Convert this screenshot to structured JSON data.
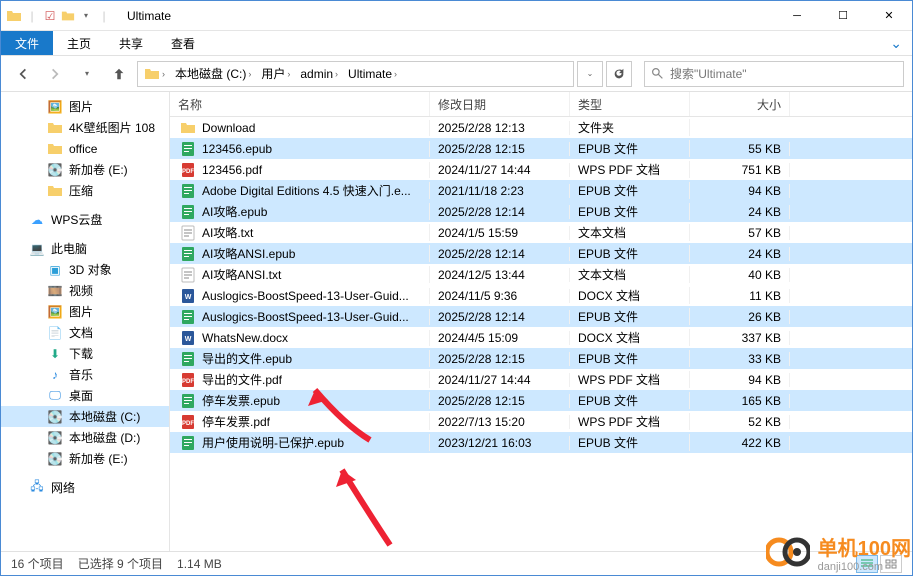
{
  "window_title": "Ultimate",
  "ribbon": {
    "file": "文件",
    "home": "主页",
    "share": "共享",
    "view": "查看"
  },
  "breadcrumbs": [
    "本地磁盘 (C:)",
    "用户",
    "admin",
    "Ultimate"
  ],
  "search_placeholder": "搜索\"Ultimate\"",
  "tree": {
    "pictures": "图片",
    "wallpaper": "4K壁纸图片 108",
    "office": "office",
    "volE": "新加卷 (E:)",
    "compress": "压缩",
    "wps": "WPS云盘",
    "thispc": "此电脑",
    "obj3d": "3D 对象",
    "videos": "视频",
    "pics2": "图片",
    "docs": "文档",
    "downloads": "下载",
    "music": "音乐",
    "desktop": "桌面",
    "volC": "本地磁盘 (C:)",
    "volD": "本地磁盘 (D:)",
    "volE2": "新加卷 (E:)",
    "network": "网络"
  },
  "columns": {
    "name": "名称",
    "date": "修改日期",
    "type": "类型",
    "size": "大小"
  },
  "rows": [
    {
      "name": "Download",
      "date": "2025/2/28 12:13",
      "type": "文件夹",
      "size": "",
      "icon": "folder",
      "sel": false
    },
    {
      "name": "123456.epub",
      "date": "2025/2/28 12:15",
      "type": "EPUB 文件",
      "size": "55 KB",
      "icon": "epub",
      "sel": true
    },
    {
      "name": "123456.pdf",
      "date": "2024/11/27 14:44",
      "type": "WPS PDF 文档",
      "size": "751 KB",
      "icon": "pdf",
      "sel": false
    },
    {
      "name": "Adobe Digital Editions 4.5 快速入门.e...",
      "date": "2021/11/18 2:23",
      "type": "EPUB 文件",
      "size": "94 KB",
      "icon": "epub",
      "sel": true
    },
    {
      "name": "AI攻略.epub",
      "date": "2025/2/28 12:14",
      "type": "EPUB 文件",
      "size": "24 KB",
      "icon": "epub",
      "sel": true
    },
    {
      "name": "AI攻略.txt",
      "date": "2024/1/5 15:59",
      "type": "文本文档",
      "size": "57 KB",
      "icon": "txt",
      "sel": false
    },
    {
      "name": "AI攻略ANSI.epub",
      "date": "2025/2/28 12:14",
      "type": "EPUB 文件",
      "size": "24 KB",
      "icon": "epub",
      "sel": true
    },
    {
      "name": "AI攻略ANSI.txt",
      "date": "2024/12/5 13:44",
      "type": "文本文档",
      "size": "40 KB",
      "icon": "txt",
      "sel": false
    },
    {
      "name": "Auslogics-BoostSpeed-13-User-Guid...",
      "date": "2024/11/5 9:36",
      "type": "DOCX 文档",
      "size": "11 KB",
      "icon": "docx",
      "sel": false
    },
    {
      "name": "Auslogics-BoostSpeed-13-User-Guid...",
      "date": "2025/2/28 12:14",
      "type": "EPUB 文件",
      "size": "26 KB",
      "icon": "epub",
      "sel": true
    },
    {
      "name": "WhatsNew.docx",
      "date": "2024/4/5 15:09",
      "type": "DOCX 文档",
      "size": "337 KB",
      "icon": "docx",
      "sel": false
    },
    {
      "name": "导出的文件.epub",
      "date": "2025/2/28 12:15",
      "type": "EPUB 文件",
      "size": "33 KB",
      "icon": "epub",
      "sel": true
    },
    {
      "name": "导出的文件.pdf",
      "date": "2024/11/27 14:44",
      "type": "WPS PDF 文档",
      "size": "94 KB",
      "icon": "pdf",
      "sel": false
    },
    {
      "name": "停车发票.epub",
      "date": "2025/2/28 12:15",
      "type": "EPUB 文件",
      "size": "165 KB",
      "icon": "epub",
      "sel": true
    },
    {
      "name": "停车发票.pdf",
      "date": "2022/7/13 15:20",
      "type": "WPS PDF 文档",
      "size": "52 KB",
      "icon": "pdf",
      "sel": false
    },
    {
      "name": "用户使用说明-已保护.epub",
      "date": "2023/12/21 16:03",
      "type": "EPUB 文件",
      "size": "422 KB",
      "icon": "epub",
      "sel": true
    }
  ],
  "status": {
    "items": "16 个项目",
    "selected": "已选择 9 个项目",
    "size": "1.14 MB"
  },
  "watermark": {
    "brand": "单机100网",
    "url": "danji100.com"
  }
}
